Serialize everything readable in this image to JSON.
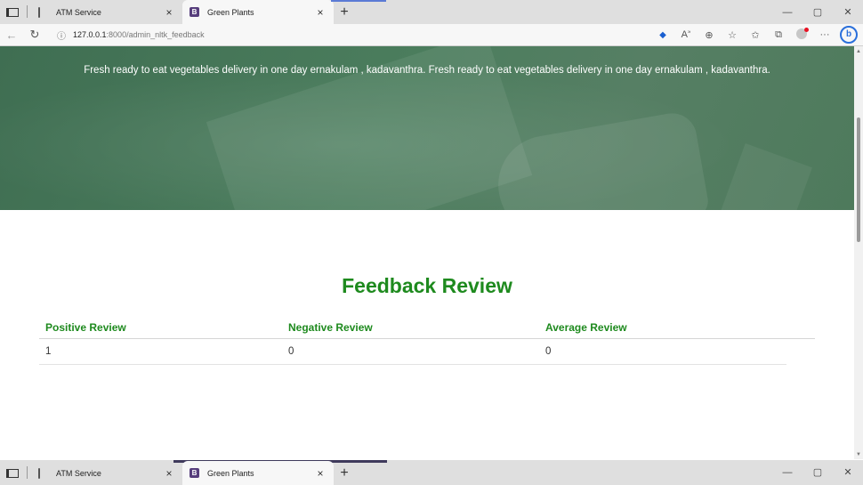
{
  "browser": {
    "tabs": [
      {
        "title": "ATM Service",
        "active": false,
        "favicon": "page-icon"
      },
      {
        "title": "Green Plants",
        "active": true,
        "favicon": "bootstrap-icon"
      }
    ],
    "url_host": "127.0.0.1",
    "url_path": ":8000/admin_nltk_feedback",
    "new_tab_label": "+",
    "close_label": "×",
    "window_controls": {
      "minimize": "—",
      "restore": "▢",
      "close": "✕"
    }
  },
  "hero": {
    "text": "Fresh ready to eat vegetables delivery in one day ernakulam , kadavanthra. Fresh ready to eat vegetables delivery in one day ernakulam , kadavanthra."
  },
  "feedback": {
    "title": "Feedback Review",
    "headers": [
      "Positive Review",
      "Negative Review",
      "Average Review"
    ],
    "values": [
      "1",
      "0",
      "0"
    ]
  },
  "colors": {
    "hero_green": "#4b7d5d",
    "accent_green": "#1e8a1e"
  }
}
